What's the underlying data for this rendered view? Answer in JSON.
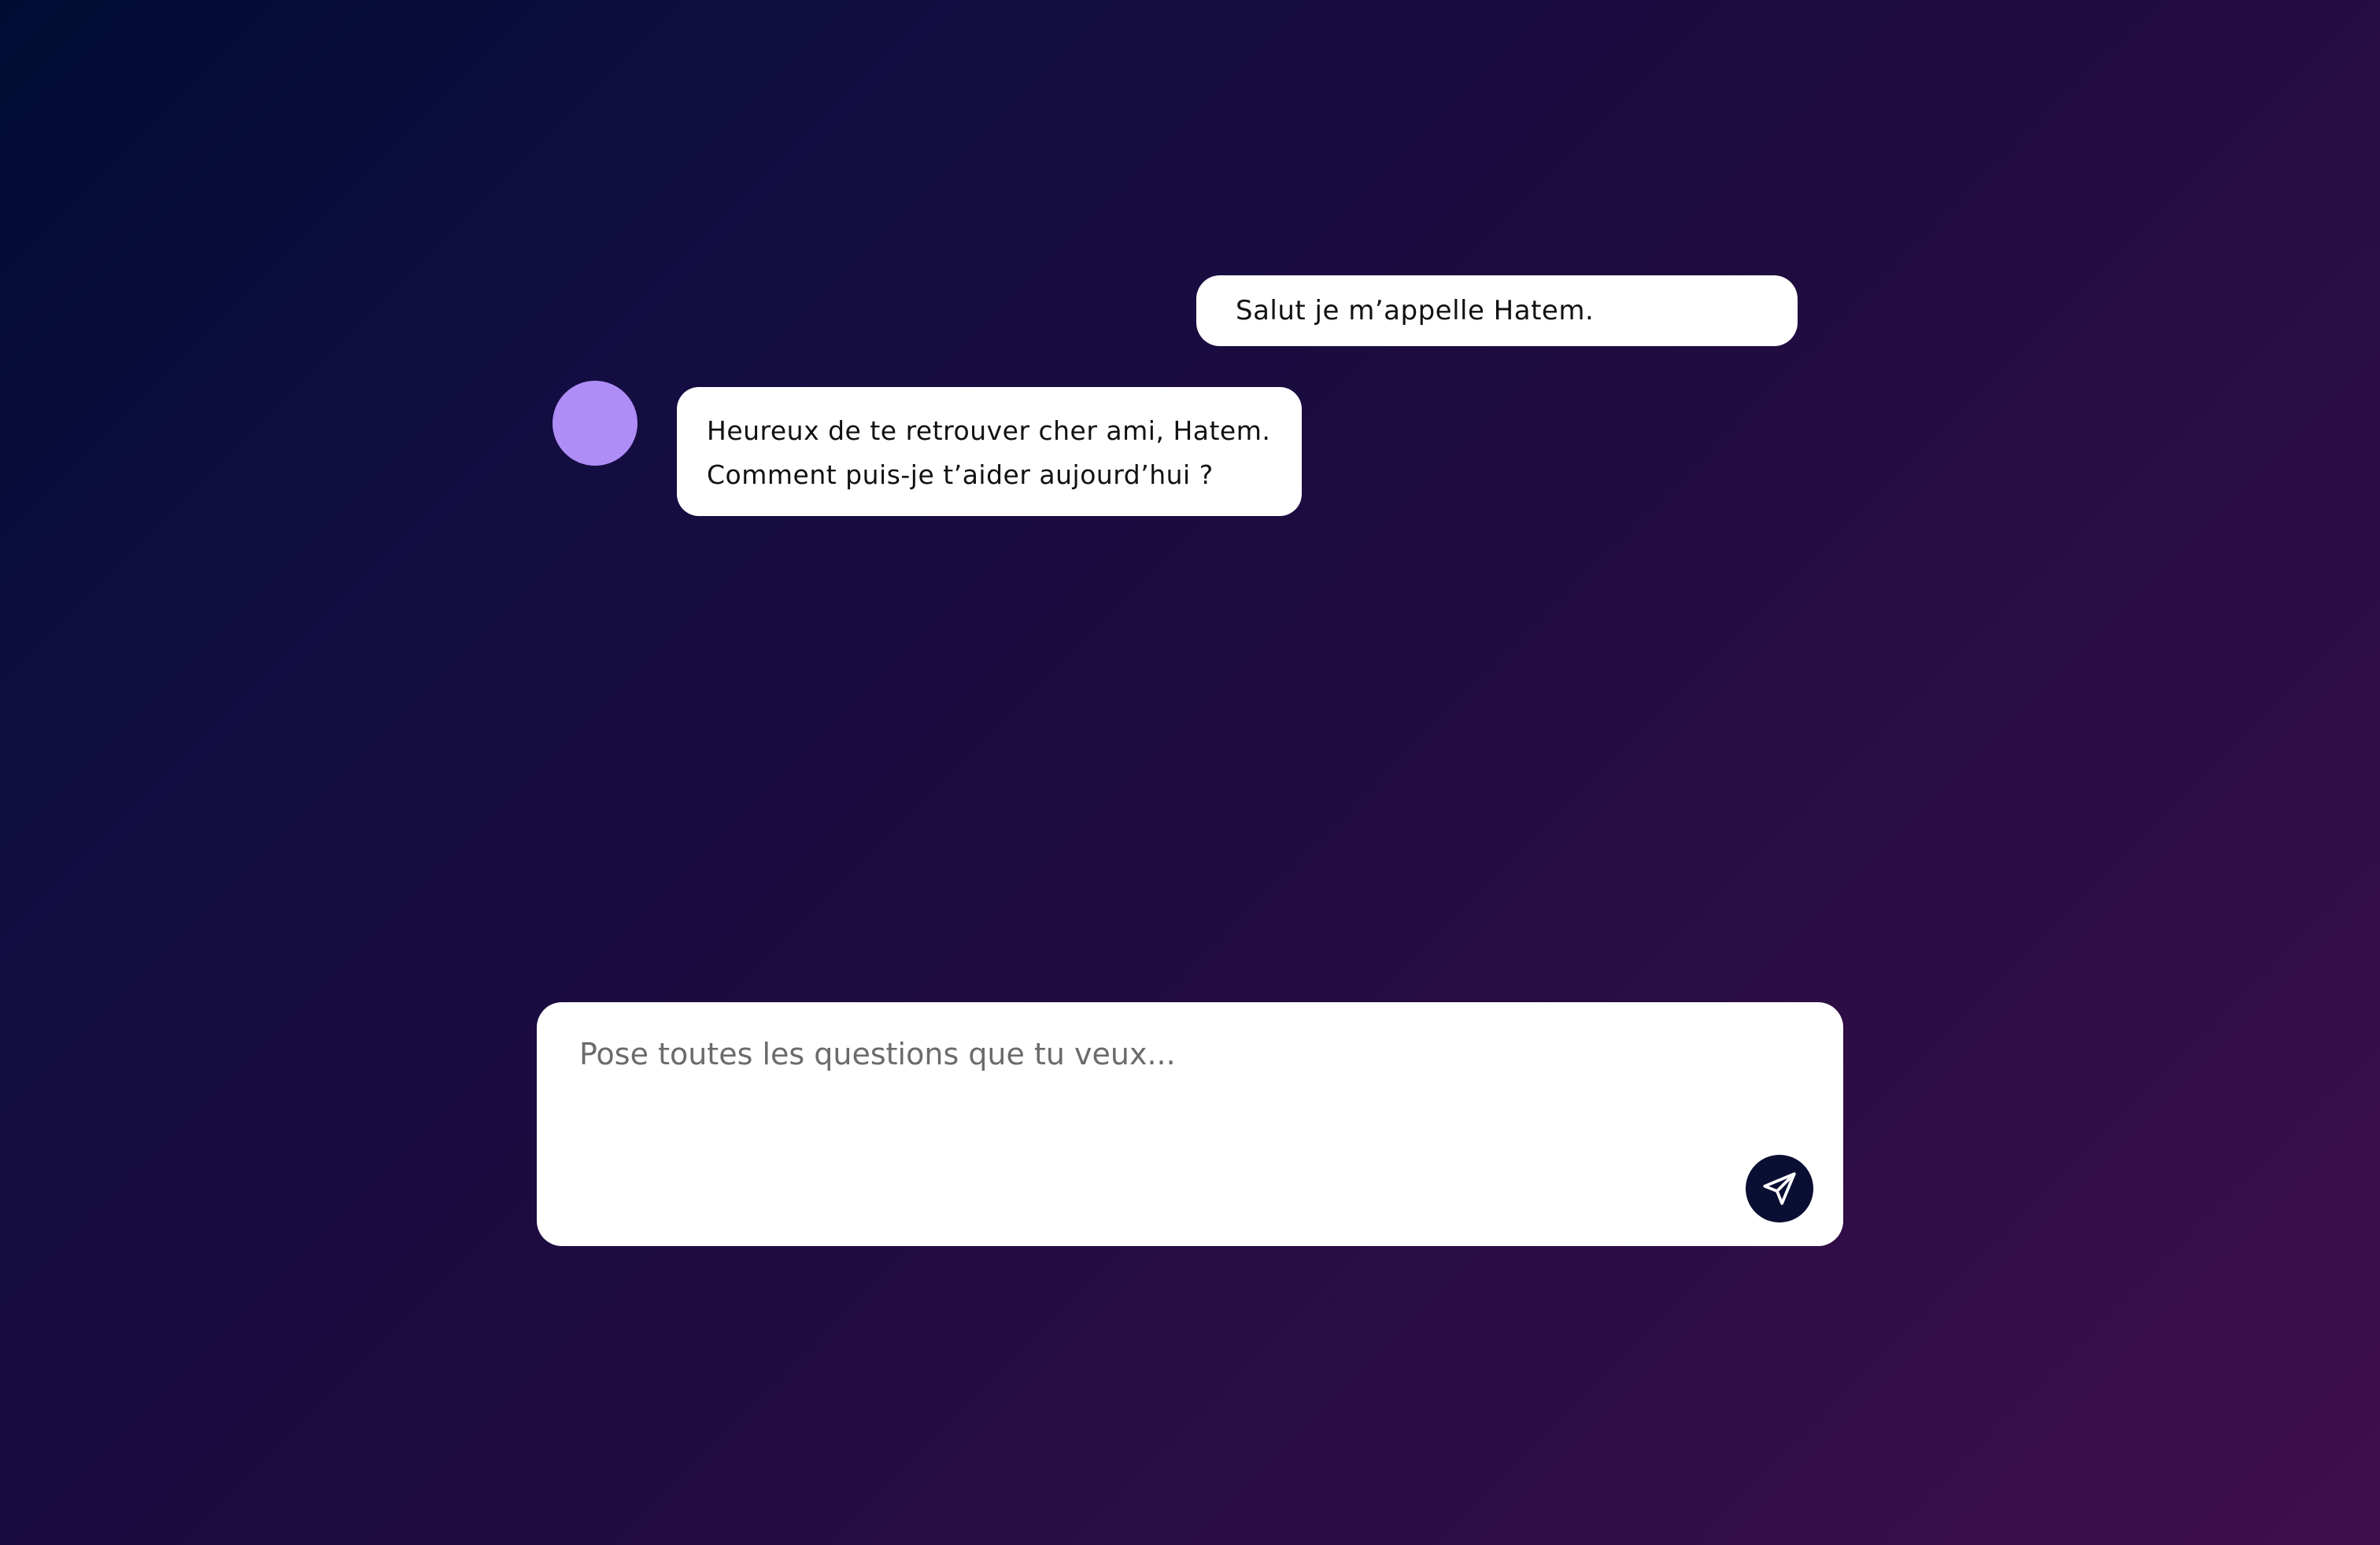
{
  "colors": {
    "avatar": "#af8df7",
    "bubble_background": "#ffffff",
    "send_button": "#0a0e33",
    "send_icon": "#ffffff"
  },
  "conversation": {
    "user_message": "Salut je m’appelle Hatem.",
    "assistant_message": {
      "lines": [
        "Heureux de te retrouver cher ami, Hatem.",
        "Comment puis-je t’aider aujourd’hui ?"
      ]
    }
  },
  "composer": {
    "placeholder": "Pose toutes les questions que tu veux...",
    "value": "",
    "send_icon": "send-icon"
  }
}
